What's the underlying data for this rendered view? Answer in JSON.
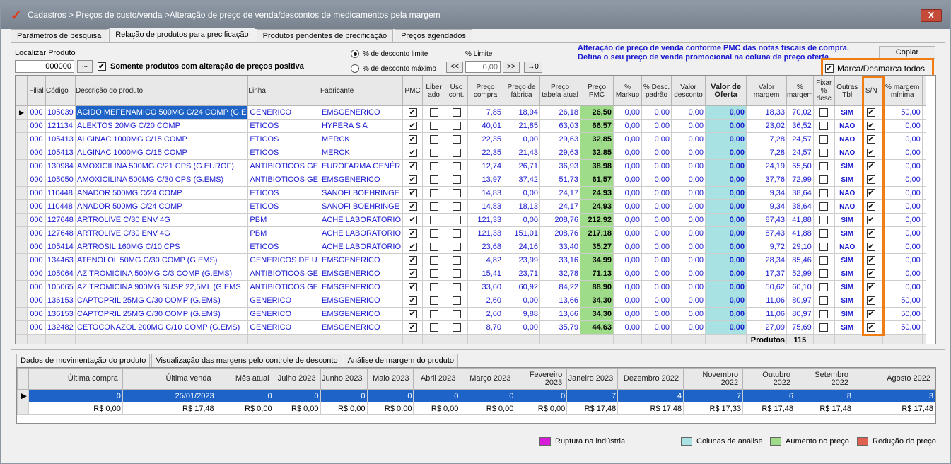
{
  "window": {
    "title": "Cadastros > Preços de custo/venda >Alteração de preço de venda/descontos de medicamentos pela margem",
    "close": "X"
  },
  "tabs": [
    {
      "label": "Parâmetros de pesquisa"
    },
    {
      "label": "Relação de produtos para precificação"
    },
    {
      "label": "Produtos pendentes de precificação"
    },
    {
      "label": "Preços agendados"
    }
  ],
  "filters": {
    "localizar_label": "Localizar Produto",
    "localizar_value": "000000",
    "ellipsis": "...",
    "somente_label": "Somente produtos com alteração de preços positiva",
    "radio_limite": "% de desconto limite",
    "radio_maximo": "% de desconto máximo",
    "pct_limite_label": "% Limite",
    "pct_limite_value": "0,00",
    "btn_prev": "<<",
    "btn_next": ">>",
    "btn_apply": "→0"
  },
  "notice": {
    "line1": "Alteração de preço de venda conforme PMC das notas fiscais de compra.",
    "line2": "Defina o seu preço de venda promocional na coluna de preço oferta."
  },
  "copiar": "Copiar",
  "marca_todos": "Marca/Desmarca todos",
  "grid": {
    "headers": [
      "Filial",
      "Código",
      "Descrição do produto",
      "Linha",
      "Fabricante",
      "PMC",
      "Liber ado",
      "Uso cont.",
      "Preço compra",
      "Preço de fábrica",
      "Preço tabela atual",
      "Preço PMC",
      "% Markup",
      "% Desc. padrão",
      "Valor desconto",
      "Valor de Oferta",
      "Valor margem",
      "% margem",
      "Fixar % desc",
      "Outras Tbl",
      "S/N",
      "% margem mínima"
    ],
    "rows": [
      {
        "filial": "000",
        "codigo": "105039",
        "desc": "ACIDO MEFENAMICO 500MG C/24 COMP (G.E",
        "linha": "GENERICO",
        "fab": "EMSGENERICO",
        "pmc": true,
        "lib": false,
        "uso": false,
        "compra": "7,85",
        "fabrica": "18,94",
        "tabela": "26,18",
        "ppmc": "26,50",
        "markup": "0,00",
        "desc_pad": "0,00",
        "val_desc": "0,00",
        "oferta": "0,00",
        "val_marg": "18,33",
        "pct_marg": "70,02",
        "fixar": false,
        "outras": "SIM",
        "sn": true,
        "min": "50,00"
      },
      {
        "filial": "000",
        "codigo": "121134",
        "desc": "ALEKTOS 20MG C/20 COMP",
        "linha": "ETICOS",
        "fab": "HYPERA S A",
        "pmc": true,
        "lib": false,
        "uso": false,
        "compra": "40,01",
        "fabrica": "21,85",
        "tabela": "63,03",
        "ppmc": "66,57",
        "markup": "0,00",
        "desc_pad": "0,00",
        "val_desc": "0,00",
        "oferta": "0,00",
        "val_marg": "23,02",
        "pct_marg": "36,52",
        "fixar": false,
        "outras": "NAO",
        "sn": true,
        "min": "0,00"
      },
      {
        "filial": "000",
        "codigo": "105413",
        "desc": "ALGINAC 1000MG C/15 COMP",
        "linha": "ETICOS",
        "fab": "MERCK",
        "pmc": true,
        "lib": false,
        "uso": false,
        "compra": "22,35",
        "fabrica": "0,00",
        "tabela": "29,63",
        "ppmc": "32,85",
        "markup": "0,00",
        "desc_pad": "0,00",
        "val_desc": "0,00",
        "oferta": "0,00",
        "val_marg": "7,28",
        "pct_marg": "24,57",
        "fixar": false,
        "outras": "NAO",
        "sn": true,
        "min": "0,00"
      },
      {
        "filial": "000",
        "codigo": "105413",
        "desc": "ALGINAC 1000MG C/15 COMP",
        "linha": "ETICOS",
        "fab": "MERCK",
        "pmc": true,
        "lib": false,
        "uso": false,
        "compra": "22,35",
        "fabrica": "21,43",
        "tabela": "29,63",
        "ppmc": "32,85",
        "markup": "0,00",
        "desc_pad": "0,00",
        "val_desc": "0,00",
        "oferta": "0,00",
        "val_marg": "7,28",
        "pct_marg": "24,57",
        "fixar": false,
        "outras": "NAO",
        "sn": true,
        "min": "0,00"
      },
      {
        "filial": "000",
        "codigo": "130984",
        "desc": "AMOXICILINA 500MG C/21 CPS (G.EUROF)",
        "linha": "ANTIBIOTICOS GE",
        "fab": "EUROFARMA GENÉR",
        "pmc": true,
        "lib": false,
        "uso": false,
        "compra": "12,74",
        "fabrica": "26,71",
        "tabela": "36,93",
        "ppmc": "38,98",
        "markup": "0,00",
        "desc_pad": "0,00",
        "val_desc": "0,00",
        "oferta": "0,00",
        "val_marg": "24,19",
        "pct_marg": "65,50",
        "fixar": false,
        "outras": "SIM",
        "sn": true,
        "min": "0,00"
      },
      {
        "filial": "000",
        "codigo": "105050",
        "desc": "AMOXICILINA 500MG C/30 CPS (G.EMS)",
        "linha": "ANTIBIOTICOS GE",
        "fab": "EMSGENERICO",
        "pmc": true,
        "lib": false,
        "uso": false,
        "compra": "13,97",
        "fabrica": "37,42",
        "tabela": "51,73",
        "ppmc": "61,57",
        "markup": "0,00",
        "desc_pad": "0,00",
        "val_desc": "0,00",
        "oferta": "0,00",
        "val_marg": "37,76",
        "pct_marg": "72,99",
        "fixar": false,
        "outras": "SIM",
        "sn": true,
        "min": "0,00"
      },
      {
        "filial": "000",
        "codigo": "110448",
        "desc": "ANADOR 500MG C/24 COMP",
        "linha": "ETICOS",
        "fab": "SANOFI BOEHRINGE",
        "pmc": true,
        "lib": false,
        "uso": false,
        "compra": "14,83",
        "fabrica": "0,00",
        "tabela": "24,17",
        "ppmc": "24,93",
        "markup": "0,00",
        "desc_pad": "0,00",
        "val_desc": "0,00",
        "oferta": "0,00",
        "val_marg": "9,34",
        "pct_marg": "38,64",
        "fixar": false,
        "outras": "NAO",
        "sn": true,
        "min": "0,00"
      },
      {
        "filial": "000",
        "codigo": "110448",
        "desc": "ANADOR 500MG C/24 COMP",
        "linha": "ETICOS",
        "fab": "SANOFI BOEHRINGE",
        "pmc": true,
        "lib": false,
        "uso": false,
        "compra": "14,83",
        "fabrica": "18,13",
        "tabela": "24,17",
        "ppmc": "24,93",
        "markup": "0,00",
        "desc_pad": "0,00",
        "val_desc": "0,00",
        "oferta": "0,00",
        "val_marg": "9,34",
        "pct_marg": "38,64",
        "fixar": false,
        "outras": "NAO",
        "sn": true,
        "min": "0,00"
      },
      {
        "filial": "000",
        "codigo": "127648",
        "desc": "ARTROLIVE C/30 ENV 4G",
        "linha": "PBM",
        "fab": "ACHE LABORATORIO",
        "pmc": true,
        "lib": false,
        "uso": false,
        "compra": "121,33",
        "fabrica": "0,00",
        "tabela": "208,76",
        "ppmc": "212,92",
        "markup": "0,00",
        "desc_pad": "0,00",
        "val_desc": "0,00",
        "oferta": "0,00",
        "val_marg": "87,43",
        "pct_marg": "41,88",
        "fixar": false,
        "outras": "SIM",
        "sn": true,
        "min": "0,00"
      },
      {
        "filial": "000",
        "codigo": "127648",
        "desc": "ARTROLIVE C/30 ENV 4G",
        "linha": "PBM",
        "fab": "ACHE LABORATORIO",
        "pmc": true,
        "lib": false,
        "uso": false,
        "compra": "121,33",
        "fabrica": "151,01",
        "tabela": "208,76",
        "ppmc": "217,18",
        "markup": "0,00",
        "desc_pad": "0,00",
        "val_desc": "0,00",
        "oferta": "0,00",
        "val_marg": "87,43",
        "pct_marg": "41,88",
        "fixar": false,
        "outras": "SIM",
        "sn": true,
        "min": "0,00"
      },
      {
        "filial": "000",
        "codigo": "105414",
        "desc": "ARTROSIL 160MG C/10 CPS",
        "linha": "ETICOS",
        "fab": "ACHE LABORATORIO",
        "pmc": true,
        "lib": false,
        "uso": false,
        "compra": "23,68",
        "fabrica": "24,16",
        "tabela": "33,40",
        "ppmc": "35,27",
        "markup": "0,00",
        "desc_pad": "0,00",
        "val_desc": "0,00",
        "oferta": "0,00",
        "val_marg": "9,72",
        "pct_marg": "29,10",
        "fixar": false,
        "outras": "NAO",
        "sn": true,
        "min": "0,00"
      },
      {
        "filial": "000",
        "codigo": "134463",
        "desc": "ATENOLOL 50MG C/30 COMP (G.EMS)",
        "linha": "GENERICOS DE U",
        "fab": "EMSGENERICO",
        "pmc": true,
        "lib": false,
        "uso": false,
        "compra": "4,82",
        "fabrica": "23,99",
        "tabela": "33,16",
        "ppmc": "34,99",
        "markup": "0,00",
        "desc_pad": "0,00",
        "val_desc": "0,00",
        "oferta": "0,00",
        "val_marg": "28,34",
        "pct_marg": "85,46",
        "fixar": false,
        "outras": "SIM",
        "sn": true,
        "min": "0,00"
      },
      {
        "filial": "000",
        "codigo": "105064",
        "desc": "AZITROMICINA 500MG C/3 COMP (G.EMS)",
        "linha": "ANTIBIOTICOS GE",
        "fab": "EMSGENERICO",
        "pmc": true,
        "lib": false,
        "uso": false,
        "compra": "15,41",
        "fabrica": "23,71",
        "tabela": "32,78",
        "ppmc": "71,13",
        "markup": "0,00",
        "desc_pad": "0,00",
        "val_desc": "0,00",
        "oferta": "0,00",
        "val_marg": "17,37",
        "pct_marg": "52,99",
        "fixar": false,
        "outras": "SIM",
        "sn": true,
        "min": "0,00"
      },
      {
        "filial": "000",
        "codigo": "105065",
        "desc": "AZITROMICINA 900MG SUSP 22,5ML (G.EMS",
        "linha": "ANTIBIOTICOS GE",
        "fab": "EMSGENERICO",
        "pmc": true,
        "lib": false,
        "uso": false,
        "compra": "33,60",
        "fabrica": "60,92",
        "tabela": "84,22",
        "ppmc": "88,90",
        "markup": "0,00",
        "desc_pad": "0,00",
        "val_desc": "0,00",
        "oferta": "0,00",
        "val_marg": "50,62",
        "pct_marg": "60,10",
        "fixar": false,
        "outras": "SIM",
        "sn": true,
        "min": "0,00"
      },
      {
        "filial": "000",
        "codigo": "136153",
        "desc": "CAPTOPRIL 25MG C/30 COMP (G.EMS)",
        "linha": "GENERICO",
        "fab": "EMSGENERICO",
        "pmc": true,
        "lib": false,
        "uso": false,
        "compra": "2,60",
        "fabrica": "0,00",
        "tabela": "13,66",
        "ppmc": "34,30",
        "markup": "0,00",
        "desc_pad": "0,00",
        "val_desc": "0,00",
        "oferta": "0,00",
        "val_marg": "11,06",
        "pct_marg": "80,97",
        "fixar": false,
        "outras": "SIM",
        "sn": true,
        "min": "50,00"
      },
      {
        "filial": "000",
        "codigo": "136153",
        "desc": "CAPTOPRIL 25MG C/30 COMP (G.EMS)",
        "linha": "GENERICO",
        "fab": "EMSGENERICO",
        "pmc": true,
        "lib": false,
        "uso": false,
        "compra": "2,60",
        "fabrica": "9,88",
        "tabela": "13,66",
        "ppmc": "34,30",
        "markup": "0,00",
        "desc_pad": "0,00",
        "val_desc": "0,00",
        "oferta": "0,00",
        "val_marg": "11,06",
        "pct_marg": "80,97",
        "fixar": false,
        "outras": "SIM",
        "sn": true,
        "min": "50,00"
      },
      {
        "filial": "000",
        "codigo": "132482",
        "desc": "CETOCONAZOL 200MG C/10 COMP (G.EMS)",
        "linha": "GENERICO",
        "fab": "EMSGENERICO",
        "pmc": true,
        "lib": false,
        "uso": false,
        "compra": "8,70",
        "fabrica": "0,00",
        "tabela": "35,79",
        "ppmc": "44,63",
        "markup": "0,00",
        "desc_pad": "0,00",
        "val_desc": "0,00",
        "oferta": "0,00",
        "val_marg": "27,09",
        "pct_marg": "75,69",
        "fixar": false,
        "outras": "SIM",
        "sn": true,
        "min": "50,00"
      }
    ],
    "footer_label": "Produtos",
    "footer_count": "115"
  },
  "bottom_tabs": [
    {
      "label": "Dados de movimentação do produto"
    },
    {
      "label": "Visualização das margens pelo controle de desconto"
    },
    {
      "label": "Análise de margem do produto"
    }
  ],
  "movement": {
    "headers": [
      "Última compra",
      "Última venda",
      "Mês atual",
      "Julho 2023",
      "Junho 2023",
      "Maio 2023",
      "Abril 2023",
      "Março 2023",
      "Fevereiro 2023",
      "Janeiro 2023",
      "Dezembro 2022",
      "Novembro 2022",
      "Outubro 2022",
      "Setembro 2022",
      "Agosto 2022"
    ],
    "row1": [
      "0",
      "25/01/2023",
      "0",
      "0",
      "0",
      "0",
      "0",
      "0",
      "0",
      "7",
      "4",
      "7",
      "6",
      "8",
      "3"
    ],
    "row2": [
      "R$ 0,00",
      "R$ 17,48",
      "R$ 0,00",
      "R$ 0,00",
      "R$ 0,00",
      "R$ 0,00",
      "R$ 0,00",
      "R$ 0,00",
      "R$ 0,00",
      "R$ 17,48",
      "R$ 17,48",
      "R$ 17,33",
      "R$ 17,48",
      "R$ 17,48",
      "R$ 17,48"
    ]
  },
  "legend": [
    {
      "label": "Ruptura na indústria",
      "color": "#d81bd8"
    },
    {
      "label": "Colunas de análise",
      "color": "#a9e2e2"
    },
    {
      "label": "Aumento no preço",
      "color": "#9fdc8a"
    },
    {
      "label": "Redução do preço",
      "color": "#e06050"
    }
  ]
}
